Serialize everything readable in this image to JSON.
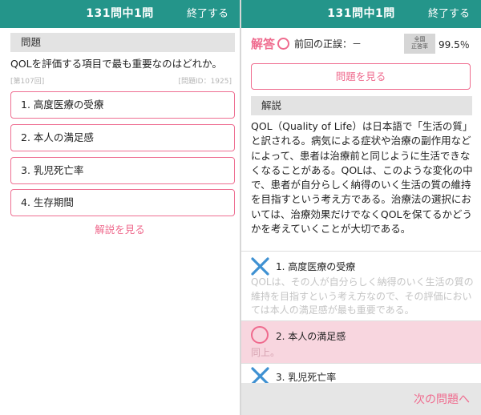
{
  "left": {
    "header": {
      "title": "131問中1問",
      "end_label": "終了する"
    },
    "section_label": "問題",
    "question": "QOLを評価する項目で最も重要なのはどれか。",
    "meta_left": "[第107回]",
    "meta_right": "[問題ID：1925]",
    "choices": [
      {
        "label": "1. 高度医療の受療"
      },
      {
        "label": "2. 本人の満足感"
      },
      {
        "label": "3. 乳児死亡率"
      },
      {
        "label": "4. 生存期間"
      }
    ],
    "explain_link": "解説を見る"
  },
  "right": {
    "header": {
      "title": "131問中1問",
      "end_label": "終了する"
    },
    "answer_label": "解答",
    "answer_icon": "circle-icon",
    "prev_result": "前回の正誤：－",
    "rate_badge_line1": "全国",
    "rate_badge_line2": "正答率",
    "rate_value": "99.5％",
    "view_question_button": "問題を見る",
    "section_label": "解説",
    "explanation": "QOL（Quality of Life）は日本語で「生活の質」と訳される。病気による症状や治療の副作用などによって、患者は治療前と同じように生活できなくなることがある。QOLは、このような変化の中で、患者が自分らしく納得のいく生活の質の維持を目指すという考え方である。治療法の選択においては、治療効果だけでなくQOLを保てるかどうかを考えていくことが大切である。",
    "options": [
      {
        "label": "1. 高度医療の受療",
        "note": "QOLは、その人が自分らしく納得のいく生活の質の維持を目指すという考え方なので、その評価においては本人の満足感が最も重要である。",
        "mark": "cross-icon"
      },
      {
        "label": "2. 本人の満足感",
        "note": "同上。",
        "mark": "circle-icon"
      },
      {
        "label": "3. 乳児死亡率",
        "note": "",
        "mark": "cross-icon"
      }
    ],
    "next_button": "次の問題へ"
  },
  "colors": {
    "header_bg": "#24958a",
    "accent_pink": "#ef6b8e",
    "correct_row_bg": "#f8d6df",
    "cross_blue": "#3f91d2"
  }
}
